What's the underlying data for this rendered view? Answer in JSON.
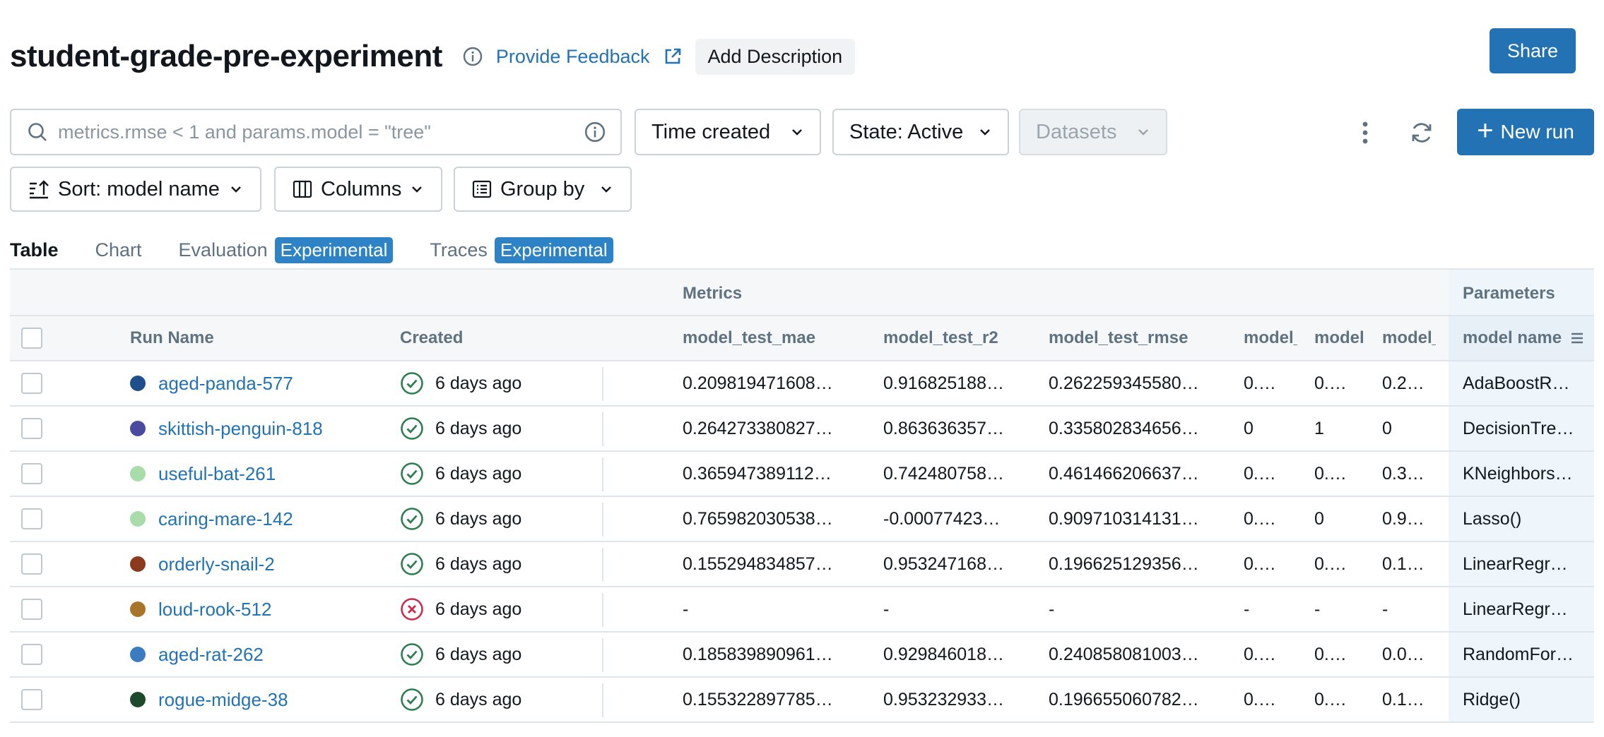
{
  "header": {
    "title": "student-grade-pre-experiment",
    "feedback_label": "Provide Feedback",
    "add_description_label": "Add Description",
    "share_label": "Share"
  },
  "toolbar": {
    "search_placeholder": "metrics.rmse < 1 and params.model = \"tree\"",
    "time_created_label": "Time created",
    "state_label": "State: Active",
    "datasets_label": "Datasets",
    "new_run_label": "New run",
    "sort_label": "Sort: model name",
    "columns_label": "Columns",
    "groupby_label": "Group by"
  },
  "tabs": [
    {
      "label": "Table",
      "badge": ""
    },
    {
      "label": "Chart",
      "badge": ""
    },
    {
      "label": "Evaluation",
      "badge": "Experimental"
    },
    {
      "label": "Traces",
      "badge": "Experimental"
    }
  ],
  "table": {
    "group_headers": {
      "metrics": "Metrics",
      "parameters": "Parameters"
    },
    "columns": [
      "Run Name",
      "Created",
      "model_test_mae",
      "model_test_r2",
      "model_test_rmse",
      "model_",
      "model",
      "model_t",
      "model name"
    ],
    "rows": [
      {
        "name": "aged-panda-577",
        "color": "#1f4e8c",
        "status": "ok",
        "created": "6 days ago",
        "mae": "0.209819471608…",
        "r2": "0.916825188…",
        "rmse": "0.262259345580…",
        "m1": "0.…",
        "m2": "0.…",
        "m3": "0.2…",
        "param": "AdaBoostR…"
      },
      {
        "name": "skittish-penguin-818",
        "color": "#4a4aa0",
        "status": "ok",
        "created": "6 days ago",
        "mae": "0.264273380827…",
        "r2": "0.863636357…",
        "rmse": "0.335802834656…",
        "m1": "0",
        "m2": "1",
        "m3": "0",
        "param": "DecisionTre…"
      },
      {
        "name": "useful-bat-261",
        "color": "#a8dca8",
        "status": "ok",
        "created": "6 days ago",
        "mae": "0.365947389112…",
        "r2": "0.742480758…",
        "rmse": "0.461466206637…",
        "m1": "0.…",
        "m2": "0.…",
        "m3": "0.3…",
        "param": "KNeighbors…"
      },
      {
        "name": "caring-mare-142",
        "color": "#a8dca8",
        "status": "ok",
        "created": "6 days ago",
        "mae": "0.765982030538…",
        "r2": "-0.00077423…",
        "rmse": "0.909710314131…",
        "m1": "0.…",
        "m2": "0",
        "m3": "0.9…",
        "param": "Lasso()"
      },
      {
        "name": "orderly-snail-2",
        "color": "#8b3a1e",
        "status": "ok",
        "created": "6 days ago",
        "mae": "0.155294834857…",
        "r2": "0.953247168…",
        "rmse": "0.196625129356…",
        "m1": "0.…",
        "m2": "0.…",
        "m3": "0.1…",
        "param": "LinearRegr…"
      },
      {
        "name": "loud-rook-512",
        "color": "#a8742a",
        "status": "fail",
        "created": "6 days ago",
        "mae": "-",
        "r2": "-",
        "rmse": "-",
        "m1": "-",
        "m2": "-",
        "m3": "-",
        "param": "LinearRegr…"
      },
      {
        "name": "aged-rat-262",
        "color": "#3b7bc0",
        "status": "ok",
        "created": "6 days ago",
        "mae": "0.185839890961…",
        "r2": "0.929846018…",
        "rmse": "0.240858081003…",
        "m1": "0.…",
        "m2": "0.…",
        "m3": "0.0…",
        "param": "RandomFor…"
      },
      {
        "name": "rogue-midge-38",
        "color": "#1d4a2a",
        "status": "ok",
        "created": "6 days ago",
        "mae": "0.155322897785…",
        "r2": "0.953232933…",
        "rmse": "0.196655060782…",
        "m1": "0.…",
        "m2": "0.…",
        "m3": "0.1…",
        "param": "Ridge()"
      }
    ]
  }
}
